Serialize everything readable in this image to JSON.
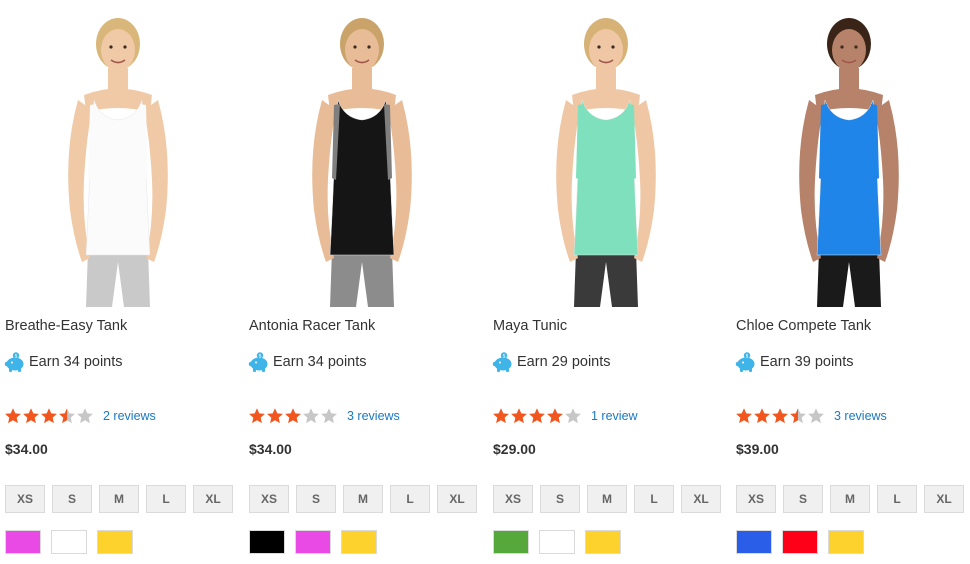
{
  "products": [
    {
      "name": "Breathe-Easy Tank",
      "reward": "Earn 34 points",
      "rating": 3.5,
      "reviews": "2 reviews",
      "price": "$34.00",
      "sizes": [
        "XS",
        "S",
        "M",
        "L",
        "XL"
      ],
      "swatches": [
        "#e94ae6",
        "#ffffff",
        "#fdd22c"
      ],
      "image": {
        "skin": "#f0c9a6",
        "hair": "#d9b77a",
        "top": "#fbfbfb",
        "bottom": "#c9c9c9",
        "accent": "#fbfbfb"
      }
    },
    {
      "name": "Antonia Racer Tank",
      "reward": "Earn 34 points",
      "rating": 3,
      "reviews": "3 reviews",
      "price": "$34.00",
      "sizes": [
        "XS",
        "S",
        "M",
        "L",
        "XL"
      ],
      "swatches": [
        "#000000",
        "#e94ae6",
        "#fdd22c"
      ],
      "image": {
        "skin": "#e9bc98",
        "hair": "#c9a36a",
        "top": "#151515",
        "bottom": "#8c8c8c",
        "accent": "#7f7f7f"
      }
    },
    {
      "name": "Maya Tunic",
      "reward": "Earn 29 points",
      "rating": 4,
      "reviews": "1 review",
      "price": "$29.00",
      "sizes": [
        "XS",
        "S",
        "M",
        "L",
        "XL"
      ],
      "swatches": [
        "#57a83a",
        "#ffffff",
        "#fdd22c"
      ],
      "image": {
        "skin": "#f0c7a4",
        "hair": "#d6b277",
        "top": "#7ee0bd",
        "bottom": "#3a3a3a",
        "accent": "#7ee0bd"
      }
    },
    {
      "name": "Chloe Compete Tank",
      "reward": "Earn 39 points",
      "rating": 3.5,
      "reviews": "3 reviews",
      "price": "$39.00",
      "sizes": [
        "XS",
        "S",
        "M",
        "L",
        "XL"
      ],
      "swatches": [
        "#2a5ee8",
        "#ff0019",
        "#fdd22c"
      ],
      "image": {
        "skin": "#b7826a",
        "hair": "#3a2418",
        "top": "#1f85e8",
        "bottom": "#1a1a1a",
        "accent": "#1f85e8"
      }
    }
  ],
  "colors": {
    "star_on": "#f1561f",
    "star_off": "#c7c7c7",
    "link": "#1979c3",
    "pig": "#3eb4e8"
  },
  "icons": {
    "reward": "piggy-bank-icon",
    "star": "star-icon"
  }
}
